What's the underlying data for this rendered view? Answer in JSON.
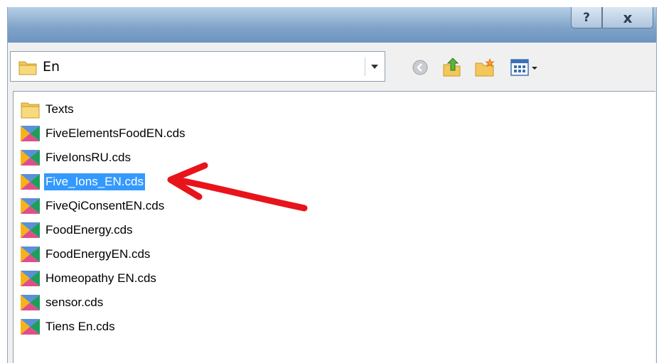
{
  "dialog": {
    "caption_buttons": {
      "help": "?",
      "close": "x"
    }
  },
  "lookin": {
    "value": "En"
  },
  "toolbar": {
    "icons": [
      "back-icon",
      "up-folder-icon",
      "new-folder-icon",
      "view-menu-icon"
    ]
  },
  "files": [
    {
      "name": "Texts",
      "type": "folder"
    },
    {
      "name": "FiveElementsFoodEN.cds",
      "type": "cds"
    },
    {
      "name": "FiveIonsRU.cds",
      "type": "cds"
    },
    {
      "name": "Five_Ions_EN.cds",
      "type": "cds",
      "selected": true
    },
    {
      "name": "FiveQiConsentEN.cds",
      "type": "cds"
    },
    {
      "name": "FoodEnergy.cds",
      "type": "cds"
    },
    {
      "name": "FoodEnergyEN.cds",
      "type": "cds"
    },
    {
      "name": "Homeopathy EN.cds",
      "type": "cds"
    },
    {
      "name": "sensor.cds",
      "type": "cds"
    },
    {
      "name": "Tiens En.cds",
      "type": "cds"
    }
  ],
  "colors": {
    "selection": "#3399ff",
    "annotation_arrow": "#e8141b",
    "titlebar": "#7ea2c7"
  }
}
